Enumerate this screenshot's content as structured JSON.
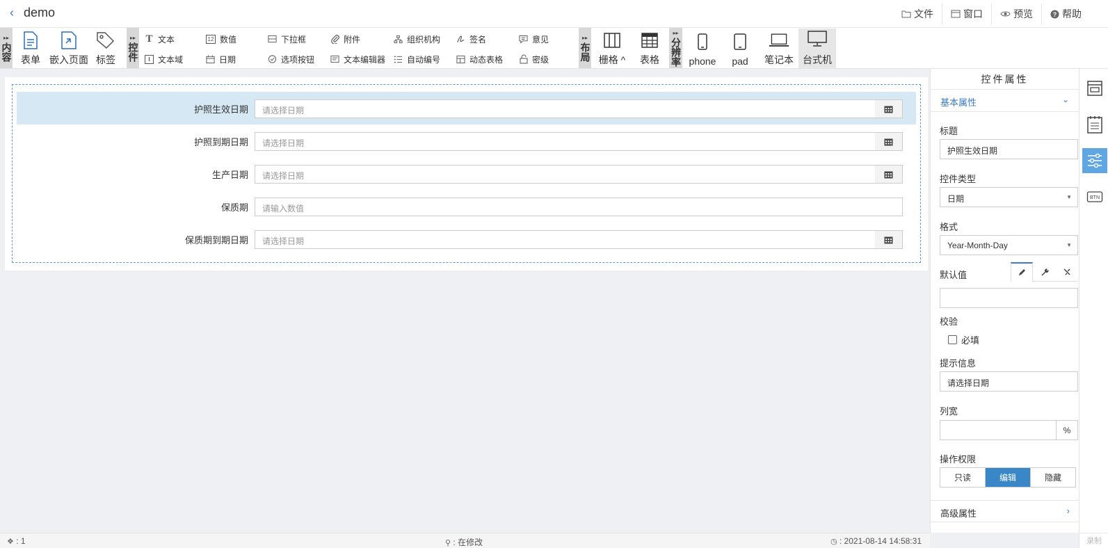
{
  "header": {
    "back_icon": "chevron-left-icon",
    "title": "demo",
    "actions": [
      {
        "icon": "folder-icon",
        "label": "文件"
      },
      {
        "icon": "window-icon",
        "label": "窗口"
      },
      {
        "icon": "eye-icon",
        "label": "预览"
      },
      {
        "icon": "help-icon",
        "label": "帮助"
      }
    ]
  },
  "toolbar": {
    "group_content": "内容",
    "group_controls": "控件",
    "group_layout": "布局",
    "group_resolution": "分辨率",
    "content_items": [
      "表单",
      "嵌入页面",
      "标签"
    ],
    "control_row1": [
      "文本",
      "数值",
      "下拉框",
      "附件",
      "组织机构",
      "签名",
      "意见"
    ],
    "control_row2": [
      "文本域",
      "日期",
      "选项按钮",
      "文本编辑器",
      "自动编号",
      "动态表格",
      "密级"
    ],
    "layout_items": [
      "栅格 ^",
      "表格"
    ],
    "resolution_items": [
      "phone",
      "pad",
      "笔记本",
      "台式机"
    ],
    "active_resolution": "台式机"
  },
  "form": {
    "rows": [
      {
        "label": "护照生效日期",
        "placeholder": "请选择日期",
        "type": "date",
        "selected": true
      },
      {
        "label": "护照到期日期",
        "placeholder": "请选择日期",
        "type": "date",
        "selected": false
      },
      {
        "label": "生产日期",
        "placeholder": "请选择日期",
        "type": "date",
        "selected": false
      },
      {
        "label": "保质期",
        "placeholder": "请输入数值",
        "type": "number",
        "selected": false
      },
      {
        "label": "保质期到期日期",
        "placeholder": "请选择日期",
        "type": "date",
        "selected": false
      }
    ]
  },
  "props": {
    "title": "控件属性",
    "basic_section": "基本属性",
    "title_label": "标题",
    "title_value": "护照生效日期",
    "type_label": "控件类型",
    "type_value": "日期",
    "format_label": "格式",
    "format_value": "Year-Month-Day",
    "default_label": "默认值",
    "default_value": "",
    "validation_label": "校验",
    "required_label": "必填",
    "required_checked": false,
    "hint_label": "提示信息",
    "hint_value": "请选择日期",
    "width_label": "列宽",
    "width_value": "",
    "width_unit": "%",
    "perm_label": "操作权限",
    "perm_options": [
      "只读",
      "编辑",
      "隐藏"
    ],
    "perm_selected": "编辑",
    "advanced_section": "高级属性"
  },
  "rail": {
    "items": [
      "layout-panel-icon",
      "notes-panel-icon",
      "sliders-icon",
      "btn-icon"
    ],
    "active": "sliders-icon",
    "footer": "录制"
  },
  "status": {
    "left": ": 1",
    "mid": ": 在修改",
    "right": ": 2021-08-14 14:58:31"
  },
  "colors": {
    "accent": "#3a87c8",
    "selected_row": "#d6e8f3",
    "dashed_border": "#5b9bd5"
  }
}
